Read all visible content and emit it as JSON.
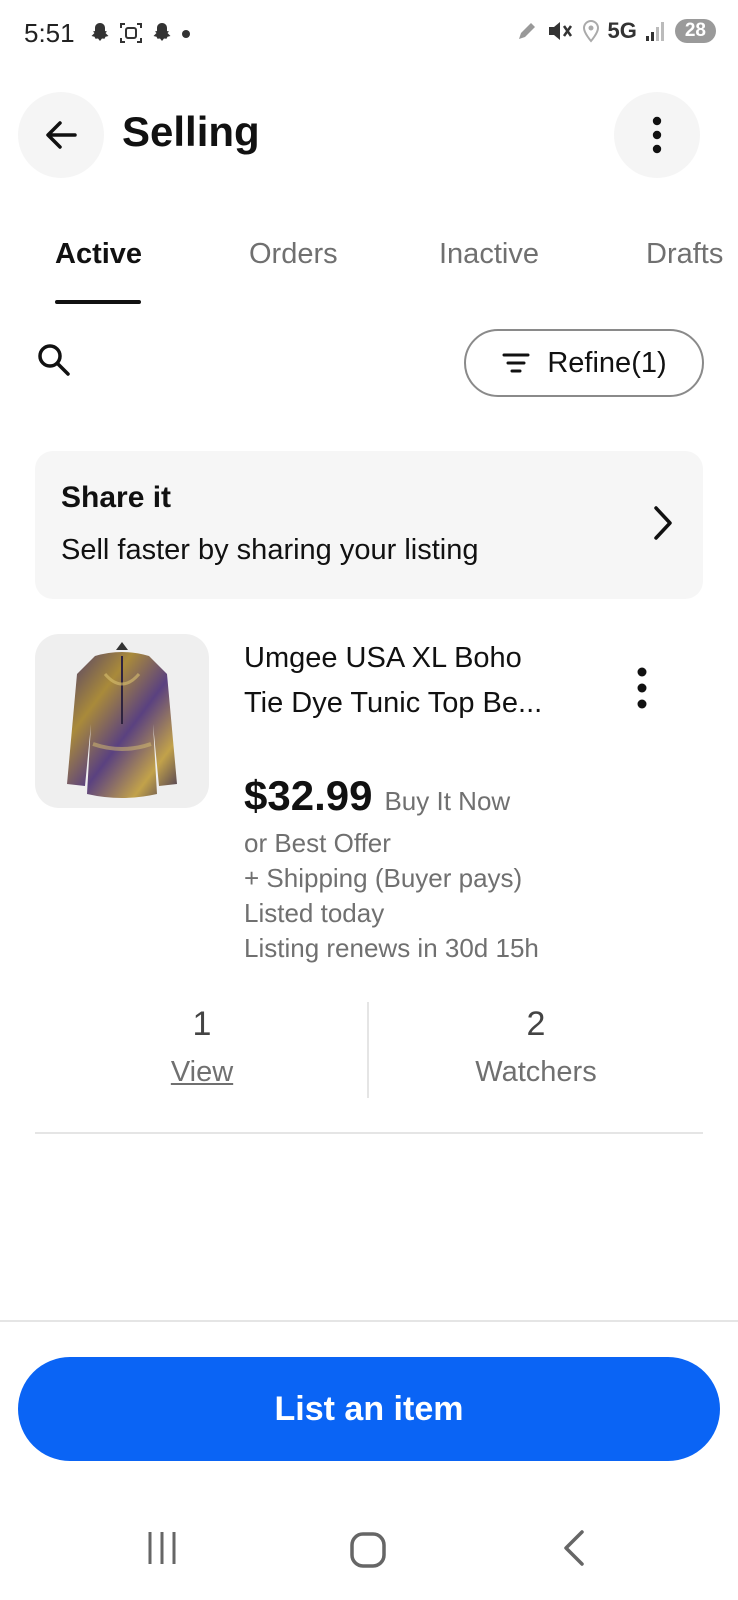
{
  "status_bar": {
    "time": "5:51",
    "network": "5G",
    "battery": "28"
  },
  "header": {
    "title": "Selling"
  },
  "tabs": [
    {
      "label": "Active",
      "active": true
    },
    {
      "label": "Orders",
      "active": false
    },
    {
      "label": "Inactive",
      "active": false
    },
    {
      "label": "Drafts",
      "active": false
    }
  ],
  "toolbar": {
    "refine_label": "Refine(1)"
  },
  "share_card": {
    "title": "Share it",
    "subtitle": "Sell faster by sharing your listing"
  },
  "listing": {
    "title_line1": "Umgee USA XL Boho",
    "title_line2": "Tie Dye Tunic Top Be...",
    "price": "$32.99",
    "format": "Buy It Now",
    "details": [
      "or Best Offer",
      "+ Shipping (Buyer pays)",
      "Listed today",
      "Listing renews in 30d 15h"
    ],
    "stats": {
      "views_value": "1",
      "views_label": "View",
      "watchers_value": "2",
      "watchers_label": "Watchers"
    }
  },
  "primary_action": {
    "label": "List an item"
  },
  "colors": {
    "accent": "#0a64f5",
    "text": "#111111",
    "muted": "#707070"
  }
}
